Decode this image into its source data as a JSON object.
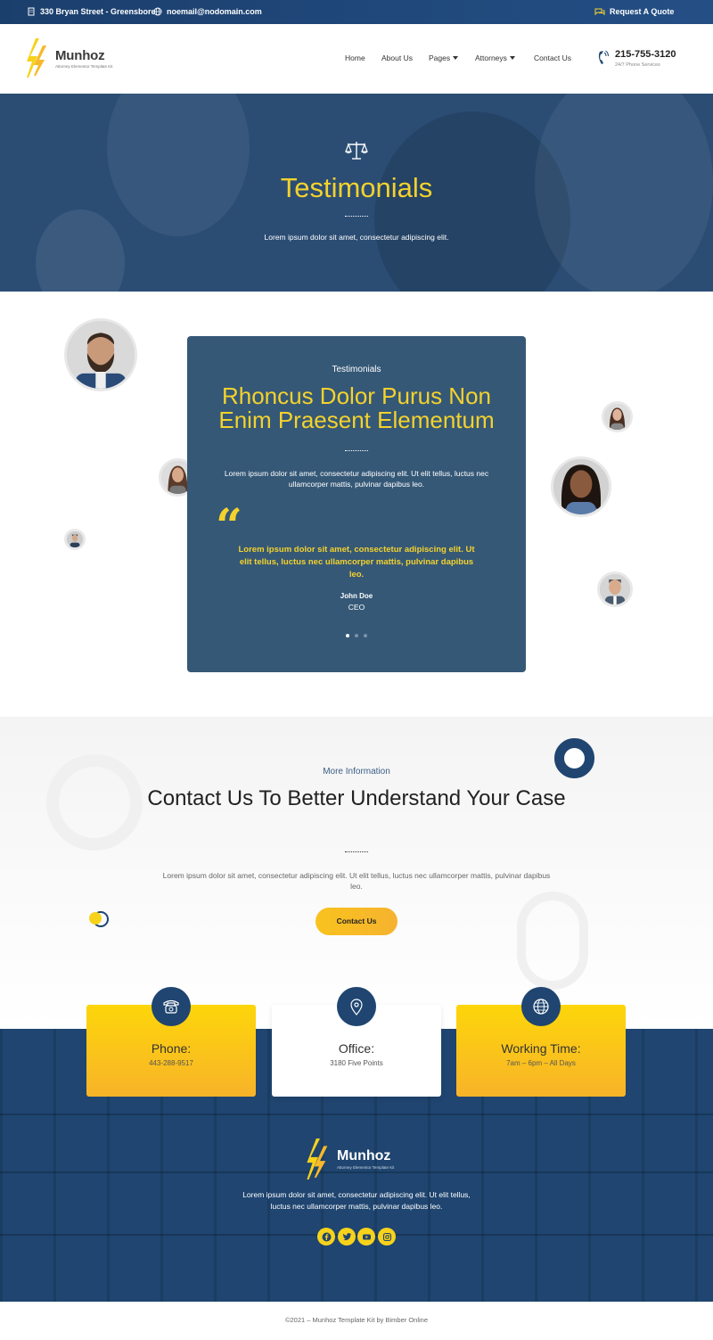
{
  "topbar": {
    "address": "330 Bryan Street - Greensbore",
    "email": "noemail@nodomain.com",
    "quote_link": "Request A Quote"
  },
  "header": {
    "logo_name": "Munhoz",
    "logo_sub": "Attorney Elementor Template Kit",
    "nav": {
      "home": "Home",
      "about": "About Us",
      "pages": "Pages",
      "attorneys": "Attorneys",
      "contact": "Contact Us"
    },
    "phone": "215-755-3120",
    "phone_label": "24/7 Phone Services"
  },
  "hero": {
    "title": "Testimonials",
    "description": "Lorem ipsum dolor sit amet, consectetur adipiscing elit."
  },
  "testimonial_card": {
    "eyebrow": "Testimonials",
    "title": "Rhoncus Dolor Purus Non Enim Praesent Elementum",
    "description": "Lorem ipsum dolor sit amet, consectetur adipiscing elit. Ut elit tellus, luctus nec ullamcorper mattis, pulvinar dapibus leo.",
    "quote_mark": "“",
    "quote": "Lorem ipsum dolor sit amet, consectetur adipiscing elit. Ut elit tellus, luctus nec ullamcorper mattis, pulvinar dapibus leo.",
    "author": "John Doe",
    "role": "CEO"
  },
  "contact_section": {
    "eyebrow": "More Information",
    "title": "Contact Us To Better Understand Your Case",
    "description": "Lorem ipsum dolor sit amet, consectetur adipiscing elit. Ut elit tellus, luctus nec ullamcorper mattis, pulvinar dapibus leo.",
    "button": "Contact Us"
  },
  "info_boxes": {
    "phone": {
      "title": "Phone:",
      "value": "443-288-9517"
    },
    "office": {
      "title": "Office:",
      "value": "3180 Five Points"
    },
    "hours": {
      "title": "Working Time:",
      "value": "7am – 6pm – All Days"
    }
  },
  "footer": {
    "logo_name": "Munhoz",
    "logo_sub": "Attorney Elementor Template Kit",
    "description": "Lorem ipsum dolor sit amet, consectetur adipiscing elit. Ut elit tellus, luctus nec ullamcorper mattis, pulvinar dapibus leo.",
    "copyright": "©2021 – Munhoz Template Kit by Bimber Online"
  },
  "colors": {
    "brand_blue": "#1f4570",
    "card_blue": "#355877",
    "accent_yellow": "#f4d22c"
  }
}
